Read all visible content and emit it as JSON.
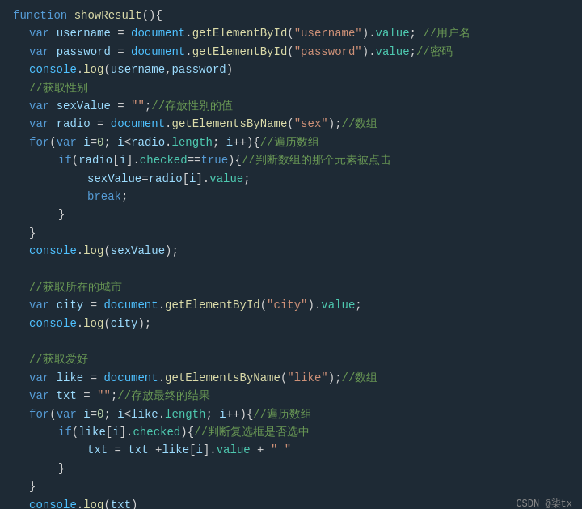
{
  "brand": "CSDN @柒tx",
  "lines": [
    {
      "indent": 0,
      "tokens": [
        {
          "cls": "kw",
          "text": "function"
        },
        {
          "cls": "plain",
          "text": " "
        },
        {
          "cls": "fn",
          "text": "showResult"
        },
        {
          "cls": "plain",
          "text": "(){"
        }
      ]
    },
    {
      "indent": 1,
      "tokens": [
        {
          "cls": "kw",
          "text": "var"
        },
        {
          "cls": "plain",
          "text": " "
        },
        {
          "cls": "id",
          "text": "username"
        },
        {
          "cls": "plain",
          "text": " = "
        },
        {
          "cls": "obj",
          "text": "document"
        },
        {
          "cls": "plain",
          "text": "."
        },
        {
          "cls": "method",
          "text": "getElementById"
        },
        {
          "cls": "plain",
          "text": "("
        },
        {
          "cls": "str",
          "text": "\"username\""
        },
        {
          "cls": "plain",
          "text": ")."
        },
        {
          "cls": "prop",
          "text": "value"
        },
        {
          "cls": "plain",
          "text": "; "
        },
        {
          "cls": "comment",
          "text": "//用户名"
        }
      ]
    },
    {
      "indent": 1,
      "tokens": [
        {
          "cls": "kw",
          "text": "var"
        },
        {
          "cls": "plain",
          "text": " "
        },
        {
          "cls": "id",
          "text": "password"
        },
        {
          "cls": "plain",
          "text": " = "
        },
        {
          "cls": "obj",
          "text": "document"
        },
        {
          "cls": "plain",
          "text": "."
        },
        {
          "cls": "method",
          "text": "getElementById"
        },
        {
          "cls": "plain",
          "text": "("
        },
        {
          "cls": "str",
          "text": "\"password\""
        },
        {
          "cls": "plain",
          "text": ")."
        },
        {
          "cls": "prop",
          "text": "value"
        },
        {
          "cls": "plain",
          "text": ";"
        },
        {
          "cls": "comment",
          "text": "//密码"
        }
      ]
    },
    {
      "indent": 1,
      "tokens": [
        {
          "cls": "obj",
          "text": "console"
        },
        {
          "cls": "plain",
          "text": "."
        },
        {
          "cls": "method",
          "text": "log"
        },
        {
          "cls": "plain",
          "text": "("
        },
        {
          "cls": "id",
          "text": "username"
        },
        {
          "cls": "plain",
          "text": ","
        },
        {
          "cls": "id",
          "text": "password"
        },
        {
          "cls": "plain",
          "text": ")"
        }
      ]
    },
    {
      "indent": 1,
      "tokens": [
        {
          "cls": "comment",
          "text": "//获取性别"
        }
      ]
    },
    {
      "indent": 1,
      "tokens": [
        {
          "cls": "kw",
          "text": "var"
        },
        {
          "cls": "plain",
          "text": " "
        },
        {
          "cls": "id",
          "text": "sexValue"
        },
        {
          "cls": "plain",
          "text": " = "
        },
        {
          "cls": "str",
          "text": "\"\""
        },
        {
          "cls": "plain",
          "text": ";"
        },
        {
          "cls": "comment",
          "text": "//存放性别的值"
        }
      ]
    },
    {
      "indent": 1,
      "tokens": [
        {
          "cls": "kw",
          "text": "var"
        },
        {
          "cls": "plain",
          "text": " "
        },
        {
          "cls": "id",
          "text": "radio"
        },
        {
          "cls": "plain",
          "text": " = "
        },
        {
          "cls": "obj",
          "text": "document"
        },
        {
          "cls": "plain",
          "text": "."
        },
        {
          "cls": "method",
          "text": "getElementsByName"
        },
        {
          "cls": "plain",
          "text": "("
        },
        {
          "cls": "str",
          "text": "\"sex\""
        },
        {
          "cls": "plain",
          "text": ");"
        },
        {
          "cls": "comment",
          "text": "//数组"
        }
      ]
    },
    {
      "indent": 1,
      "tokens": [
        {
          "cls": "kw",
          "text": "for"
        },
        {
          "cls": "plain",
          "text": "("
        },
        {
          "cls": "kw",
          "text": "var"
        },
        {
          "cls": "plain",
          "text": " "
        },
        {
          "cls": "id",
          "text": "i"
        },
        {
          "cls": "plain",
          "text": "="
        },
        {
          "cls": "num",
          "text": "0"
        },
        {
          "cls": "plain",
          "text": "; "
        },
        {
          "cls": "id",
          "text": "i"
        },
        {
          "cls": "plain",
          "text": "<"
        },
        {
          "cls": "id",
          "text": "radio"
        },
        {
          "cls": "plain",
          "text": "."
        },
        {
          "cls": "prop",
          "text": "length"
        },
        {
          "cls": "plain",
          "text": "; "
        },
        {
          "cls": "id",
          "text": "i"
        },
        {
          "cls": "plain",
          "text": "++){"
        },
        {
          "cls": "comment",
          "text": "//遍历数组"
        }
      ]
    },
    {
      "indent": 2,
      "tokens": [
        {
          "cls": "kw",
          "text": "if"
        },
        {
          "cls": "plain",
          "text": "("
        },
        {
          "cls": "id",
          "text": "radio"
        },
        {
          "cls": "plain",
          "text": "["
        },
        {
          "cls": "id",
          "text": "i"
        },
        {
          "cls": "plain",
          "text": "]."
        },
        {
          "cls": "prop",
          "text": "checked"
        },
        {
          "cls": "plain",
          "text": "=="
        },
        {
          "cls": "kw",
          "text": "true"
        },
        {
          "cls": "plain",
          "text": "){"
        },
        {
          "cls": "comment",
          "text": "//判断数组的那个元素被点击"
        }
      ]
    },
    {
      "indent": 3,
      "tokens": [
        {
          "cls": "id",
          "text": "sexValue"
        },
        {
          "cls": "plain",
          "text": "="
        },
        {
          "cls": "id",
          "text": "radio"
        },
        {
          "cls": "plain",
          "text": "["
        },
        {
          "cls": "id",
          "text": "i"
        },
        {
          "cls": "plain",
          "text": "]."
        },
        {
          "cls": "prop",
          "text": "value"
        },
        {
          "cls": "plain",
          "text": ";"
        }
      ]
    },
    {
      "indent": 3,
      "tokens": [
        {
          "cls": "kw",
          "text": "break"
        },
        {
          "cls": "plain",
          "text": ";"
        }
      ]
    },
    {
      "indent": 2,
      "tokens": [
        {
          "cls": "plain",
          "text": "}"
        }
      ]
    },
    {
      "indent": 1,
      "tokens": [
        {
          "cls": "plain",
          "text": "}"
        }
      ]
    },
    {
      "indent": 1,
      "tokens": [
        {
          "cls": "obj",
          "text": "console"
        },
        {
          "cls": "plain",
          "text": "."
        },
        {
          "cls": "method",
          "text": "log"
        },
        {
          "cls": "plain",
          "text": "("
        },
        {
          "cls": "id",
          "text": "sexValue"
        },
        {
          "cls": "plain",
          "text": ");"
        }
      ]
    },
    {
      "indent": 0,
      "tokens": []
    },
    {
      "indent": 1,
      "tokens": [
        {
          "cls": "comment",
          "text": "//获取所在的城市"
        }
      ]
    },
    {
      "indent": 1,
      "tokens": [
        {
          "cls": "kw",
          "text": "var"
        },
        {
          "cls": "plain",
          "text": " "
        },
        {
          "cls": "id",
          "text": "city"
        },
        {
          "cls": "plain",
          "text": " = "
        },
        {
          "cls": "obj",
          "text": "document"
        },
        {
          "cls": "plain",
          "text": "."
        },
        {
          "cls": "method",
          "text": "getElementById"
        },
        {
          "cls": "plain",
          "text": "("
        },
        {
          "cls": "str",
          "text": "\"city\""
        },
        {
          "cls": "plain",
          "text": ")."
        },
        {
          "cls": "prop",
          "text": "value"
        },
        {
          "cls": "plain",
          "text": ";"
        }
      ]
    },
    {
      "indent": 1,
      "tokens": [
        {
          "cls": "obj",
          "text": "console"
        },
        {
          "cls": "plain",
          "text": "."
        },
        {
          "cls": "method",
          "text": "log"
        },
        {
          "cls": "plain",
          "text": "("
        },
        {
          "cls": "id",
          "text": "city"
        },
        {
          "cls": "plain",
          "text": ");"
        }
      ]
    },
    {
      "indent": 0,
      "tokens": []
    },
    {
      "indent": 1,
      "tokens": [
        {
          "cls": "comment",
          "text": "//获取爱好"
        }
      ]
    },
    {
      "indent": 1,
      "tokens": [
        {
          "cls": "kw",
          "text": "var"
        },
        {
          "cls": "plain",
          "text": " "
        },
        {
          "cls": "id",
          "text": "like"
        },
        {
          "cls": "plain",
          "text": " = "
        },
        {
          "cls": "obj",
          "text": "document"
        },
        {
          "cls": "plain",
          "text": "."
        },
        {
          "cls": "method",
          "text": "getElementsByName"
        },
        {
          "cls": "plain",
          "text": "("
        },
        {
          "cls": "str",
          "text": "\"like\""
        },
        {
          "cls": "plain",
          "text": ");"
        },
        {
          "cls": "comment",
          "text": "//数组"
        }
      ]
    },
    {
      "indent": 1,
      "tokens": [
        {
          "cls": "kw",
          "text": "var"
        },
        {
          "cls": "plain",
          "text": " "
        },
        {
          "cls": "id",
          "text": "txt"
        },
        {
          "cls": "plain",
          "text": " = "
        },
        {
          "cls": "str",
          "text": "\"\""
        },
        {
          "cls": "plain",
          "text": ";"
        },
        {
          "cls": "comment",
          "text": "//存放最终的结果"
        }
      ]
    },
    {
      "indent": 1,
      "tokens": [
        {
          "cls": "kw",
          "text": "for"
        },
        {
          "cls": "plain",
          "text": "("
        },
        {
          "cls": "kw",
          "text": "var"
        },
        {
          "cls": "plain",
          "text": " "
        },
        {
          "cls": "id",
          "text": "i"
        },
        {
          "cls": "plain",
          "text": "="
        },
        {
          "cls": "num",
          "text": "0"
        },
        {
          "cls": "plain",
          "text": "; "
        },
        {
          "cls": "id",
          "text": "i"
        },
        {
          "cls": "plain",
          "text": "<"
        },
        {
          "cls": "id",
          "text": "like"
        },
        {
          "cls": "plain",
          "text": "."
        },
        {
          "cls": "prop",
          "text": "length"
        },
        {
          "cls": "plain",
          "text": "; "
        },
        {
          "cls": "id",
          "text": "i"
        },
        {
          "cls": "plain",
          "text": "++){"
        },
        {
          "cls": "comment",
          "text": "//遍历数组"
        }
      ]
    },
    {
      "indent": 2,
      "tokens": [
        {
          "cls": "kw",
          "text": "if"
        },
        {
          "cls": "plain",
          "text": "("
        },
        {
          "cls": "id",
          "text": "like"
        },
        {
          "cls": "plain",
          "text": "["
        },
        {
          "cls": "id",
          "text": "i"
        },
        {
          "cls": "plain",
          "text": "]."
        },
        {
          "cls": "prop",
          "text": "checked"
        },
        {
          "cls": "plain",
          "text": "){"
        },
        {
          "cls": "comment",
          "text": "//判断复选框是否选中"
        }
      ]
    },
    {
      "indent": 3,
      "tokens": [
        {
          "cls": "id",
          "text": "txt"
        },
        {
          "cls": "plain",
          "text": " = "
        },
        {
          "cls": "id",
          "text": "txt"
        },
        {
          "cls": "plain",
          "text": " +"
        },
        {
          "cls": "id",
          "text": "like"
        },
        {
          "cls": "plain",
          "text": "["
        },
        {
          "cls": "id",
          "text": "i"
        },
        {
          "cls": "plain",
          "text": "]."
        },
        {
          "cls": "prop",
          "text": "value"
        },
        {
          "cls": "plain",
          "text": " + "
        },
        {
          "cls": "str",
          "text": "\" \""
        }
      ]
    },
    {
      "indent": 2,
      "tokens": [
        {
          "cls": "plain",
          "text": "}"
        }
      ]
    },
    {
      "indent": 1,
      "tokens": [
        {
          "cls": "plain",
          "text": "}"
        }
      ]
    },
    {
      "indent": 1,
      "tokens": [
        {
          "cls": "obj",
          "text": "console"
        },
        {
          "cls": "plain",
          "text": "."
        },
        {
          "cls": "method",
          "text": "log"
        },
        {
          "cls": "plain",
          "text": "("
        },
        {
          "cls": "id",
          "text": "txt"
        },
        {
          "cls": "plain",
          "text": ")"
        }
      ]
    }
  ]
}
